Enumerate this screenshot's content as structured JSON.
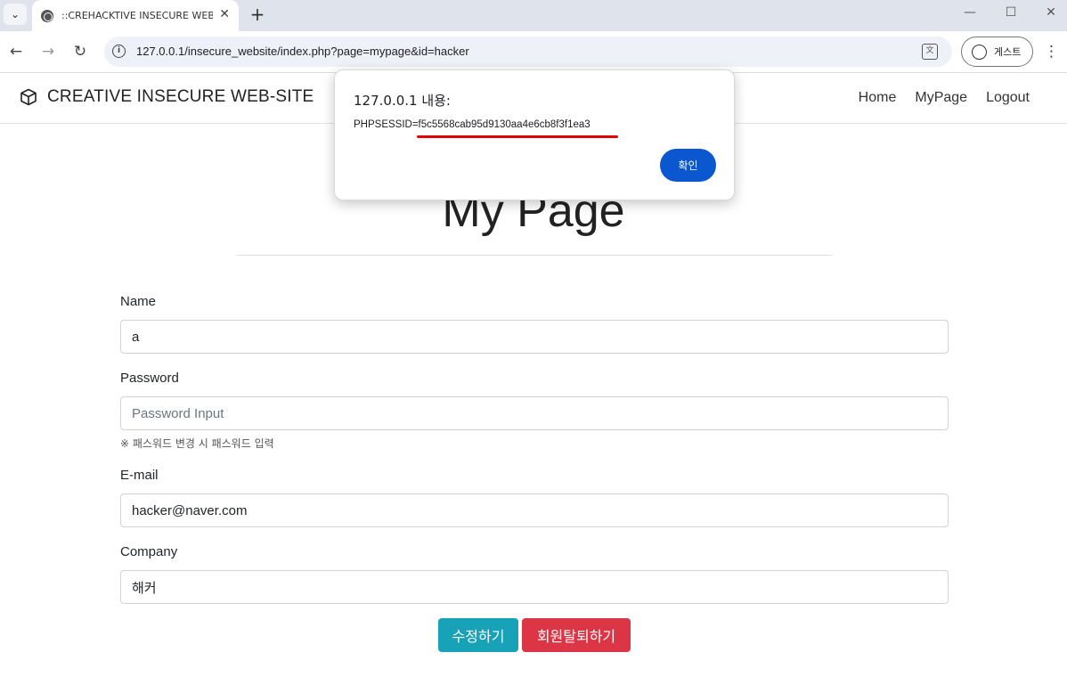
{
  "browser": {
    "tab_title": "::CREHACKTIVE INSECURE WEB-SITE",
    "tab_close": "✕",
    "new_tab": "+",
    "url": "127.0.0.1/insecure_website/index.php?page=mypage&id=hacker",
    "guest_label": "게스트",
    "minimize": "—",
    "maximize": "☐",
    "close": "✕"
  },
  "site": {
    "brand": "CREATIVE INSECURE WEB-SITE",
    "nav": [
      "Home",
      "MyPage",
      "Logout"
    ]
  },
  "page": {
    "title": "My Page",
    "fields": {
      "name": {
        "label": "Name",
        "value": "a"
      },
      "password": {
        "label": "Password",
        "placeholder": "Password Input",
        "hint": "※ 패스워드 변경 시 패스워드 입력"
      },
      "email": {
        "label": "E-mail",
        "value": "hacker@naver.com"
      },
      "company": {
        "label": "Company",
        "value": "해커"
      }
    },
    "buttons": {
      "edit": "수정하기",
      "delete": "회원탈퇴하기"
    }
  },
  "dialog": {
    "title": "127.0.0.1 내용:",
    "message": "PHPSESSID=f5c5568cab95d9130aa4e6cb8f3f1ea3",
    "ok": "확인"
  },
  "colors": {
    "edit_button": "#17a2b8",
    "delete_button": "#dc3545",
    "dialog_ok": "#0b57d0",
    "highlight": "#e30000"
  }
}
